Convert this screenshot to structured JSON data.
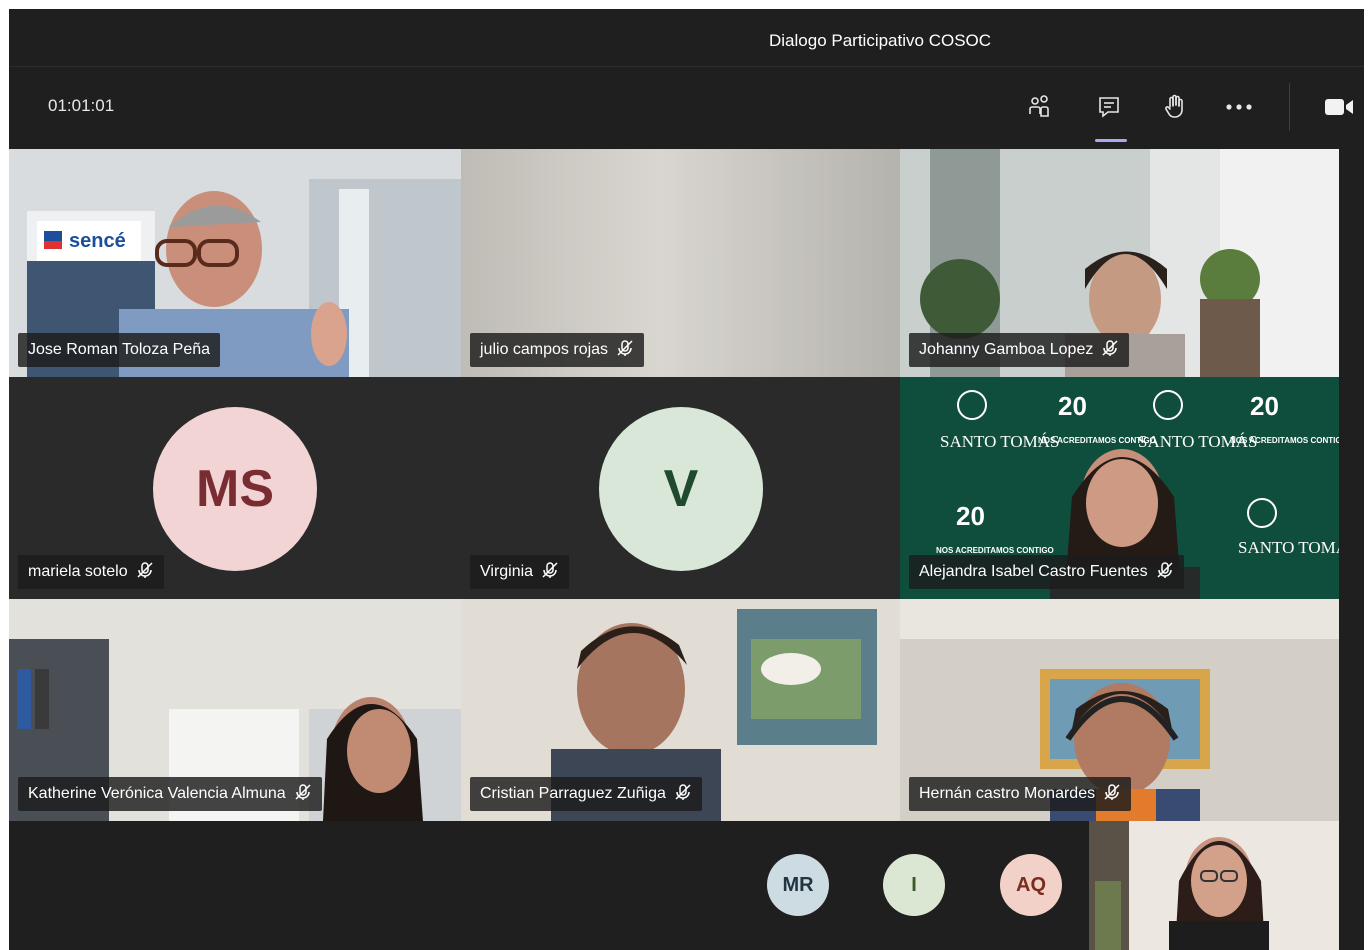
{
  "meeting": {
    "title": "Dialogo Participativo COSOC",
    "timer": "01:01:01"
  },
  "toolbar": {
    "icons": [
      "people-icon",
      "chat-icon",
      "raise-hand-icon",
      "more-options-icon",
      "camera-icon"
    ]
  },
  "participants": [
    {
      "name": "Jose Roman Toloza Peña",
      "muted": false,
      "video": true
    },
    {
      "name": "julio campos rojas",
      "muted": true,
      "video": true
    },
    {
      "name": "Johanny Gamboa Lopez",
      "muted": true,
      "video": true
    },
    {
      "name": "mariela sotelo",
      "muted": true,
      "initials": "MS",
      "avatar_bg": "#f2d4d4",
      "avatar_fg": "#7a2c33"
    },
    {
      "name": "Virginia",
      "muted": true,
      "initials": "V",
      "avatar_bg": "#d9e7d9",
      "avatar_fg": "#1f4a2d"
    },
    {
      "name": "Alejandra Isabel Castro Fuentes",
      "muted": true,
      "video": true
    },
    {
      "name": "Katherine Verónica Valencia Almuna",
      "muted": true,
      "video": true
    },
    {
      "name": "Cristian Parraguez Zuñiga",
      "muted": true,
      "video": true
    },
    {
      "name": "Hernán castro Monardes",
      "muted": true,
      "video": true
    }
  ],
  "overflow_avatars": [
    {
      "initials": "MR",
      "bg": "#cddbe3",
      "fg": "#203642"
    },
    {
      "initials": "I",
      "bg": "#dbe7d3",
      "fg": "#3a5a2a"
    },
    {
      "initials": "AQ",
      "bg": "#f2d2c8",
      "fg": "#7a2c1e"
    }
  ],
  "background_texts": {
    "sence_logo": "sencé",
    "santo_tomas": "SANTO TOMÁS",
    "nos_acreditamos": "NOS ACREDITAMOS CONTIGO",
    "anniversary": "20"
  }
}
